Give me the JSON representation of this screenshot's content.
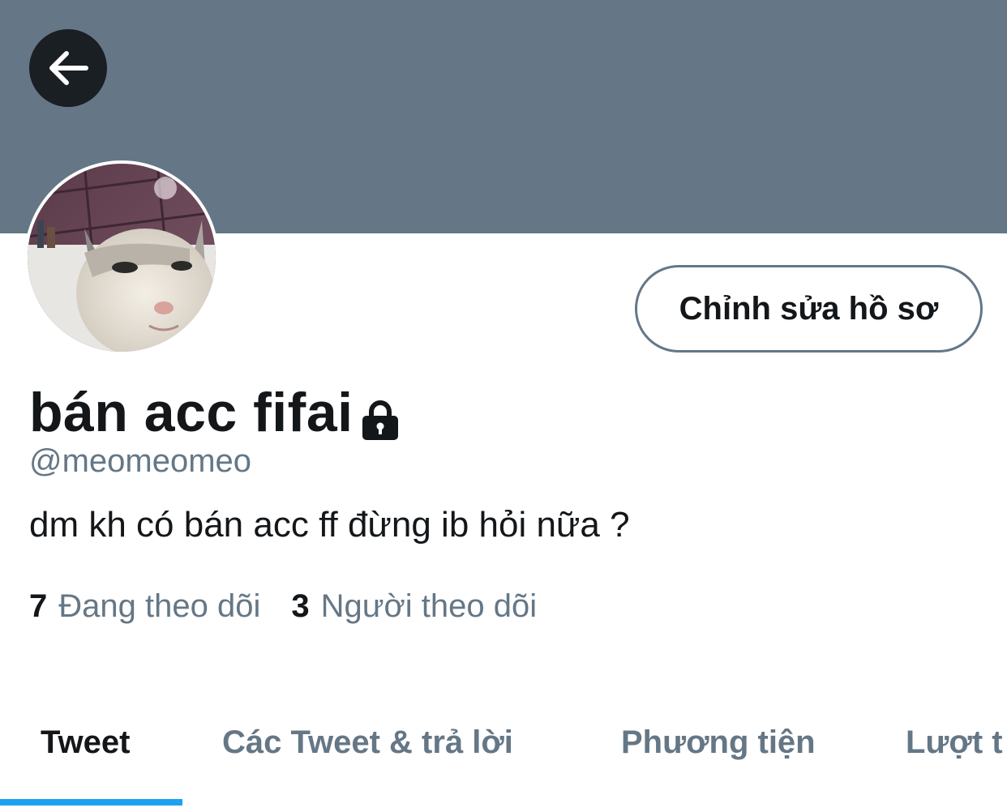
{
  "header": {
    "banner_color": "#657786",
    "back_icon": "arrow-left-icon"
  },
  "profile": {
    "display_name": "bán acc fifai",
    "protected_icon": "lock-icon",
    "handle": "@meomeomeo",
    "bio": "dm kh có bán acc ff đừng ib hỏi nữa ?",
    "edit_button_label": "Chỉnh sửa hồ sơ"
  },
  "stats": {
    "following_count": "7",
    "following_label": "Đang theo dõi",
    "followers_count": "3",
    "followers_label": "Người theo dõi"
  },
  "tabs": [
    {
      "label": "Tweet",
      "active": true
    },
    {
      "label": "Các Tweet & trả lời",
      "active": false
    },
    {
      "label": "Phương tiện",
      "active": false
    },
    {
      "label": "Lượt t",
      "active": false
    }
  ],
  "colors": {
    "primary_text": "#14171a",
    "secondary_text": "#657786",
    "accent": "#1da1f2"
  }
}
